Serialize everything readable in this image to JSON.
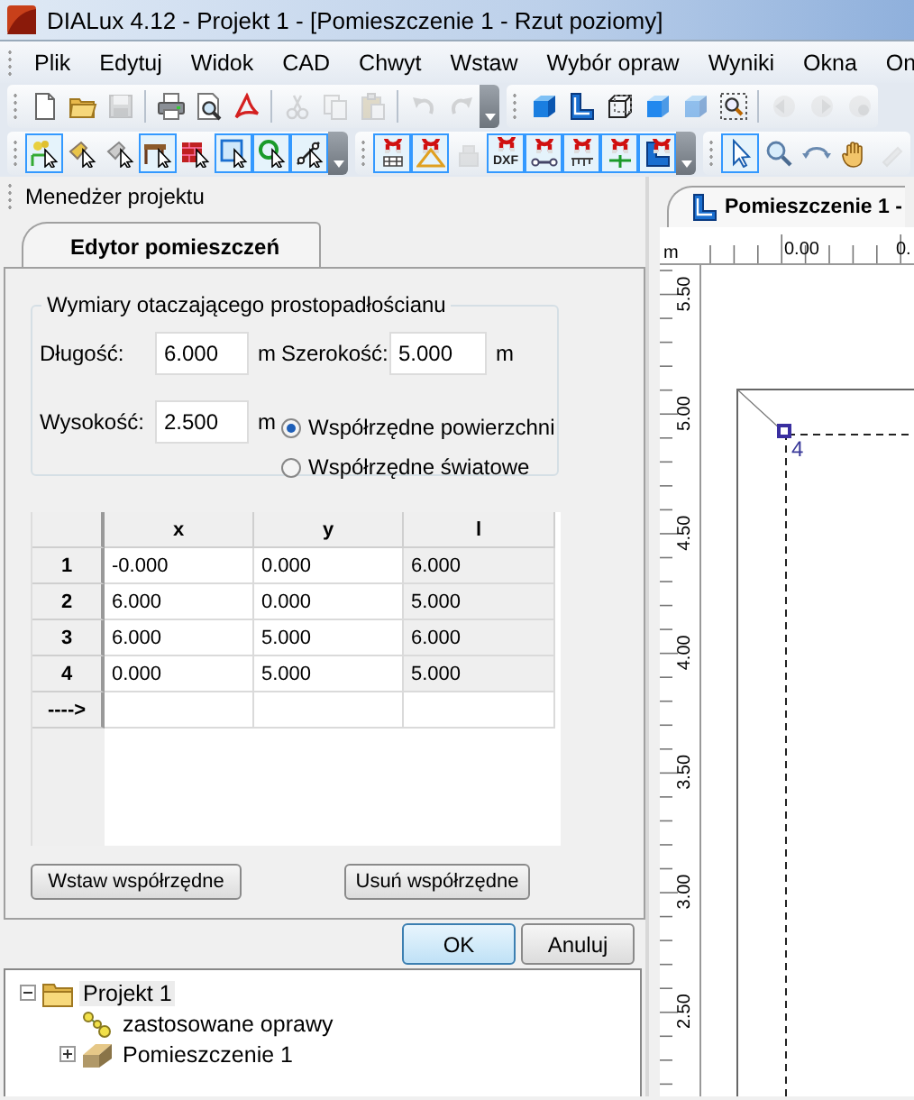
{
  "window": {
    "title": "DIALux 4.12 - Projekt 1 - [Pomieszczenie 1 - Rzut poziomy]"
  },
  "menu": [
    "Plik",
    "Edytuj",
    "Widok",
    "CAD",
    "Chwyt",
    "Wstaw",
    "Wybór opraw",
    "Wyniki",
    "Okna",
    "On"
  ],
  "toolbars": [
    {
      "groups": [
        {
          "overflow": true,
          "items": [
            {
              "kind": "button",
              "on": false,
              "disabled": false
            },
            {
              "kind": "button",
              "on": false,
              "disabled": false
            },
            {
              "kind": "button",
              "on": false,
              "disabled": true
            },
            {
              "kind": "separator"
            },
            {
              "kind": "button",
              "on": false,
              "disabled": false
            },
            {
              "kind": "button",
              "on": false,
              "disabled": false
            },
            {
              "kind": "button",
              "on": false,
              "disabled": false
            },
            {
              "kind": "separator"
            },
            {
              "kind": "button",
              "on": false,
              "disabled": true
            },
            {
              "kind": "button",
              "on": false,
              "disabled": true
            },
            {
              "kind": "button",
              "on": false,
              "disabled": true
            },
            {
              "kind": "separator"
            },
            {
              "kind": "button",
              "on": false,
              "disabled": true
            },
            {
              "kind": "button",
              "on": false,
              "disabled": true
            }
          ]
        },
        {
          "overflow": false,
          "items": [
            {
              "kind": "button",
              "on": false,
              "disabled": false
            },
            {
              "kind": "button",
              "on": false,
              "disabled": false
            },
            {
              "kind": "button",
              "on": false,
              "disabled": false
            },
            {
              "kind": "button",
              "on": false,
              "disabled": false
            },
            {
              "kind": "button",
              "on": false,
              "disabled": true
            },
            {
              "kind": "button",
              "on": false,
              "disabled": false
            },
            {
              "kind": "separator"
            },
            {
              "kind": "button",
              "on": false,
              "disabled": true
            },
            {
              "kind": "button",
              "on": false,
              "disabled": true
            },
            {
              "kind": "button",
              "on": false,
              "disabled": true
            }
          ]
        }
      ]
    },
    {
      "groups": [
        {
          "overflow": true,
          "items": [
            {
              "kind": "button",
              "on": true,
              "disabled": false
            },
            {
              "kind": "button",
              "on": false,
              "disabled": false
            },
            {
              "kind": "button",
              "on": false,
              "disabled": false
            },
            {
              "kind": "button",
              "on": true,
              "disabled": false
            },
            {
              "kind": "button",
              "on": false,
              "disabled": false
            },
            {
              "kind": "button",
              "on": true,
              "disabled": false
            },
            {
              "kind": "button",
              "on": true,
              "disabled": false
            },
            {
              "kind": "button",
              "on": true,
              "disabled": false
            }
          ]
        },
        {
          "overflow": true,
          "items": [
            {
              "kind": "button",
              "on": true,
              "disabled": false
            },
            {
              "kind": "button",
              "on": true,
              "disabled": false
            },
            {
              "kind": "button",
              "on": false,
              "disabled": true
            },
            {
              "kind": "button",
              "on": true,
              "disabled": false,
              "caption": "DXF"
            },
            {
              "kind": "button",
              "on": true,
              "disabled": false
            },
            {
              "kind": "button",
              "on": true,
              "disabled": false
            },
            {
              "kind": "button",
              "on": true,
              "disabled": false
            },
            {
              "kind": "button",
              "on": true,
              "disabled": false
            }
          ]
        },
        {
          "overflow": false,
          "items": [
            {
              "kind": "button",
              "on": true,
              "disabled": false
            },
            {
              "kind": "button",
              "on": false,
              "disabled": false
            },
            {
              "kind": "button",
              "on": false,
              "disabled": false
            },
            {
              "kind": "button",
              "on": false,
              "disabled": false
            },
            {
              "kind": "button",
              "on": false,
              "disabled": true
            }
          ]
        }
      ]
    }
  ],
  "project_manager": {
    "title": "Menedżer projektu"
  },
  "editor_tabs": [
    {
      "label": "Edytor pomieszczeń",
      "selected": true
    }
  ],
  "dimensions": {
    "title": "Wymiary otaczającego prostopadłościanu",
    "fields": [
      {
        "label": "Długość:",
        "value": "6.000",
        "unit": "m"
      },
      {
        "label": "Szerokość:",
        "value": "5.000",
        "unit": "m"
      },
      {
        "label": "Wysokość:",
        "value": "2.500",
        "unit": "m"
      }
    ],
    "coordinate_modes": [
      {
        "label": "Współrzędne powierzchni",
        "selected": true
      },
      {
        "label": "Współrzędne światowe",
        "selected": false
      }
    ]
  },
  "table": {
    "columns": [
      {
        "label": "x",
        "readonly": false
      },
      {
        "label": "y",
        "readonly": false
      },
      {
        "label": "l",
        "readonly": true
      }
    ],
    "rows": [
      {
        "label": "1",
        "cells": [
          "-0.000",
          "0.000",
          "6.000"
        ]
      },
      {
        "label": "2",
        "cells": [
          "6.000",
          "0.000",
          "5.000"
        ]
      },
      {
        "label": "3",
        "cells": [
          "6.000",
          "5.000",
          "6.000"
        ]
      },
      {
        "label": "4",
        "cells": [
          "0.000",
          "5.000",
          "5.000"
        ]
      }
    ],
    "new_row_marker": "---->"
  },
  "table_buttons": [
    "Wstaw współrzędne",
    "Usuń współrzędne"
  ],
  "dialog_buttons": [
    {
      "label": "OK",
      "default": true
    },
    {
      "label": "Anuluj",
      "default": false
    }
  ],
  "tree": [
    {
      "label": "Projekt 1",
      "kind": "folder",
      "selected": true,
      "expanded": true,
      "children": [
        {
          "label": "zastosowane oprawy",
          "kind": "luminaires",
          "selected": false
        },
        {
          "label": "Pomieszczenie 1",
          "kind": "room",
          "selected": false,
          "expanded": false
        }
      ]
    }
  ],
  "view_tabs": [
    {
      "label": "Pomieszczenie 1 -",
      "selected": true
    }
  ],
  "ruler": {
    "unit": "m",
    "top_labels": [
      "0.00",
      "0."
    ],
    "left_labels": [
      "5.50",
      "5.00",
      "4.50",
      "4.00",
      "3.50",
      "3.00",
      "2.50"
    ]
  },
  "vertex_label": "4"
}
